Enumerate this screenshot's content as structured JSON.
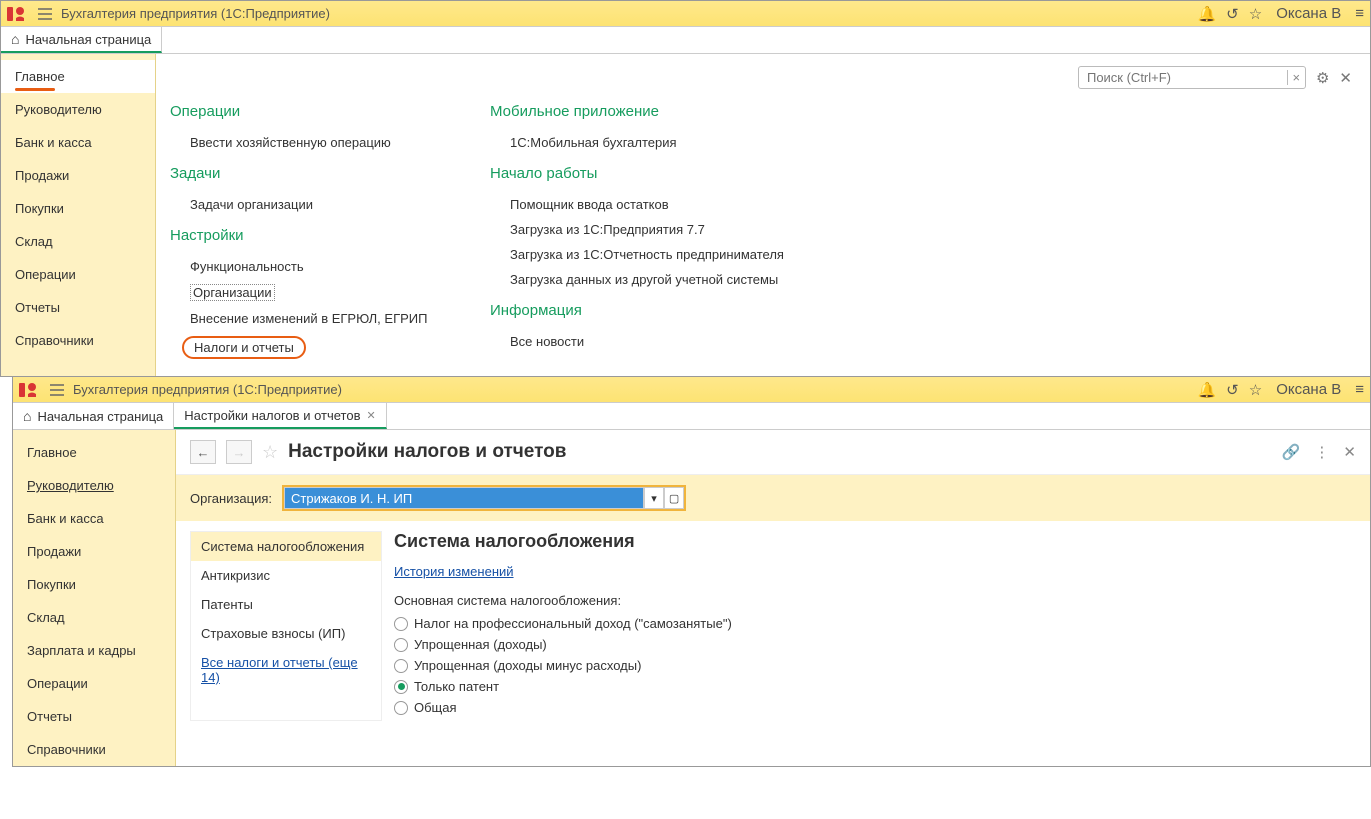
{
  "winTitle": "Бухгалтерия предприятия  (1С:Предприятие)",
  "user": "Оксана В",
  "hometab": "Начальная страница",
  "sidebar1": [
    "Главное",
    "Руководителю",
    "Банк и касса",
    "Продажи",
    "Покупки",
    "Склад",
    "Операции",
    "Отчеты",
    "Справочники"
  ],
  "search": {
    "placeholder": "Поиск (Ctrl+F)"
  },
  "sectOps": "Операции",
  "opVvesti": "Ввести хозяйственную операцию",
  "sectTasks": "Задачи",
  "tasksOrg": "Задачи организации",
  "sectSettings": "Настройки",
  "setFunc": "Функциональность",
  "setOrg": "Организации",
  "setEgr": "Внесение изменений в ЕГРЮЛ, ЕГРИП",
  "setTax": "Налоги и отчеты",
  "sectMobile": "Мобильное приложение",
  "mobBux": "1С:Мобильная бухгалтерия",
  "sectStart": "Начало работы",
  "start1": "Помощник ввода остатков",
  "start2": "Загрузка из 1С:Предприятия 7.7",
  "start3": "Загрузка из 1С:Отчетность предпринимателя",
  "start4": "Загрузка данных из другой учетной системы",
  "sectInfo": "Информация",
  "infoNews": "Все новости",
  "tab2": "Настройки налогов и отчетов",
  "sidebar2": [
    "Главное",
    "Руководителю",
    "Банк и касса",
    "Продажи",
    "Покупки",
    "Склад",
    "Зарплата и кадры",
    "Операции",
    "Отчеты",
    "Справочники"
  ],
  "c2title": "Настройки налогов и отчетов",
  "orgLabel": "Организация:",
  "orgValue": "Стрижаков И. Н. ИП",
  "c2nav": [
    "Система налогообложения",
    "Антикризис",
    "Патенты",
    "Страховые взносы (ИП)"
  ],
  "c2navlink": "Все налоги и отчеты (еще 14)",
  "c2h2": "Система налогообложения",
  "histlink": "История изменений",
  "mainlbl": "Основная система налогообложения:",
  "r1": "Налог на профессиональный доход (\"самозанятые\")",
  "r2": "Упрощенная (доходы)",
  "r3": "Упрощенная (доходы минус расходы)",
  "r4": "Только патент",
  "r5": "Общая"
}
